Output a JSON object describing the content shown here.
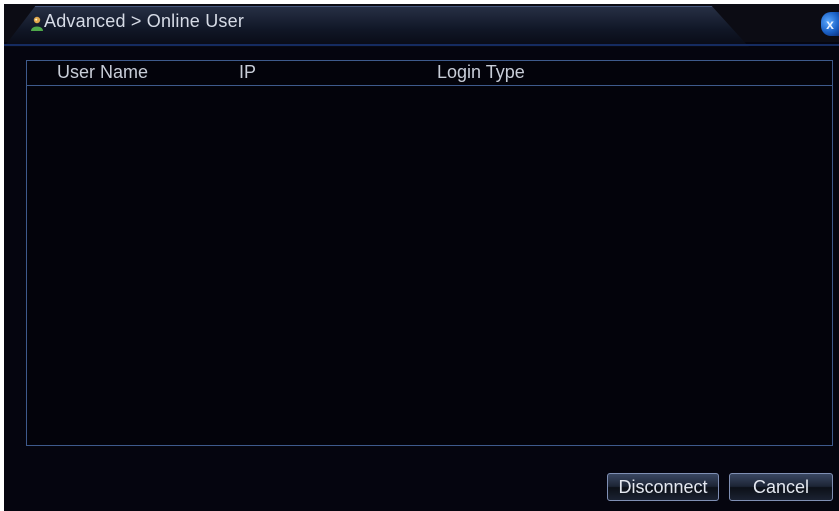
{
  "window": {
    "breadcrumb": "Advanced > Online User",
    "close_glyph": "x"
  },
  "table": {
    "columns": [
      "User Name",
      "IP",
      "Login Type"
    ],
    "rows": []
  },
  "buttons": {
    "disconnect": "Disconnect",
    "cancel": "Cancel"
  },
  "colors": {
    "window_bg": "#05050f",
    "border": "#3e5a8c",
    "accent_blue": "#1a5fc4",
    "text": "#d6dbe6"
  },
  "icons": {
    "title_icon": "user-icon",
    "close_icon": "close-icon"
  }
}
